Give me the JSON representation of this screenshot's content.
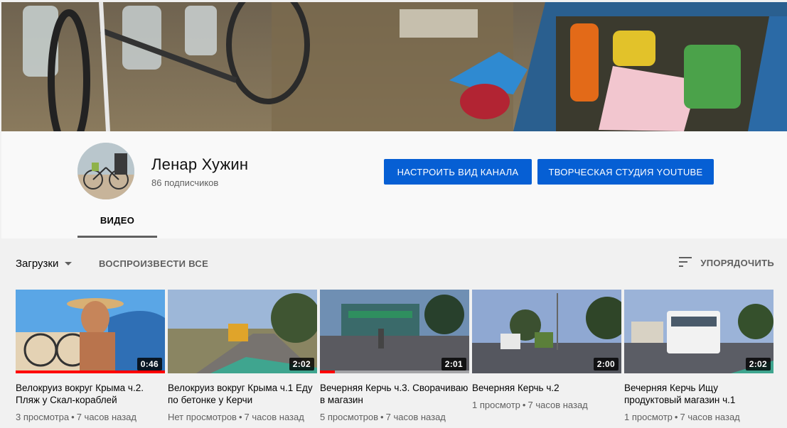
{
  "channel": {
    "name": "Ленар Хужин",
    "subscribers": "86 подписчиков",
    "customize_label": "НАСТРОИТЬ ВИД КАНАЛА",
    "studio_label": "ТВОРЧЕСКАЯ СТУДИЯ YOUTUBE"
  },
  "tabs": [
    {
      "label": "ВИДЕО",
      "active": true
    }
  ],
  "toolbar": {
    "uploads_label": "Загрузки",
    "play_all_label": "ВОСПРОИЗВЕСТИ ВСЕ",
    "sort_label": "УПОРЯДОЧИТЬ"
  },
  "colors": {
    "accent": "#065fd4",
    "progress": "#ff0000"
  },
  "videos": [
    {
      "title": "Велокруиз вокруг Крыма ч.2. Пляж у Скал-кораблей",
      "duration": "0:46",
      "views": "3 просмотра",
      "age": "7 часов назад",
      "watched_fraction": 1.0
    },
    {
      "title": "Велокруиз вокруг Крыма ч.1 Еду по бетонке у Керчи",
      "duration": "2:02",
      "views": "Нет просмотров",
      "age": "7 часов назад",
      "watched_fraction": 0
    },
    {
      "title": "Вечерняя Керчь ч.3. Сворачиваю в магазин",
      "duration": "2:01",
      "views": "5 просмотров",
      "age": "7 часов назад",
      "watched_fraction": 0.1
    },
    {
      "title": "Вечерняя Керчь ч.2",
      "duration": "2:00",
      "views": "1 просмотр",
      "age": "7 часов назад",
      "watched_fraction": 0
    },
    {
      "title": "Вечерняя Керчь Ищу продуктовый магазин ч.1",
      "duration": "2:02",
      "views": "1 просмотр",
      "age": "7 часов назад",
      "watched_fraction": 0
    }
  ],
  "icons": {
    "sort": "sort-icon",
    "dropdown": "caret-down-icon"
  }
}
